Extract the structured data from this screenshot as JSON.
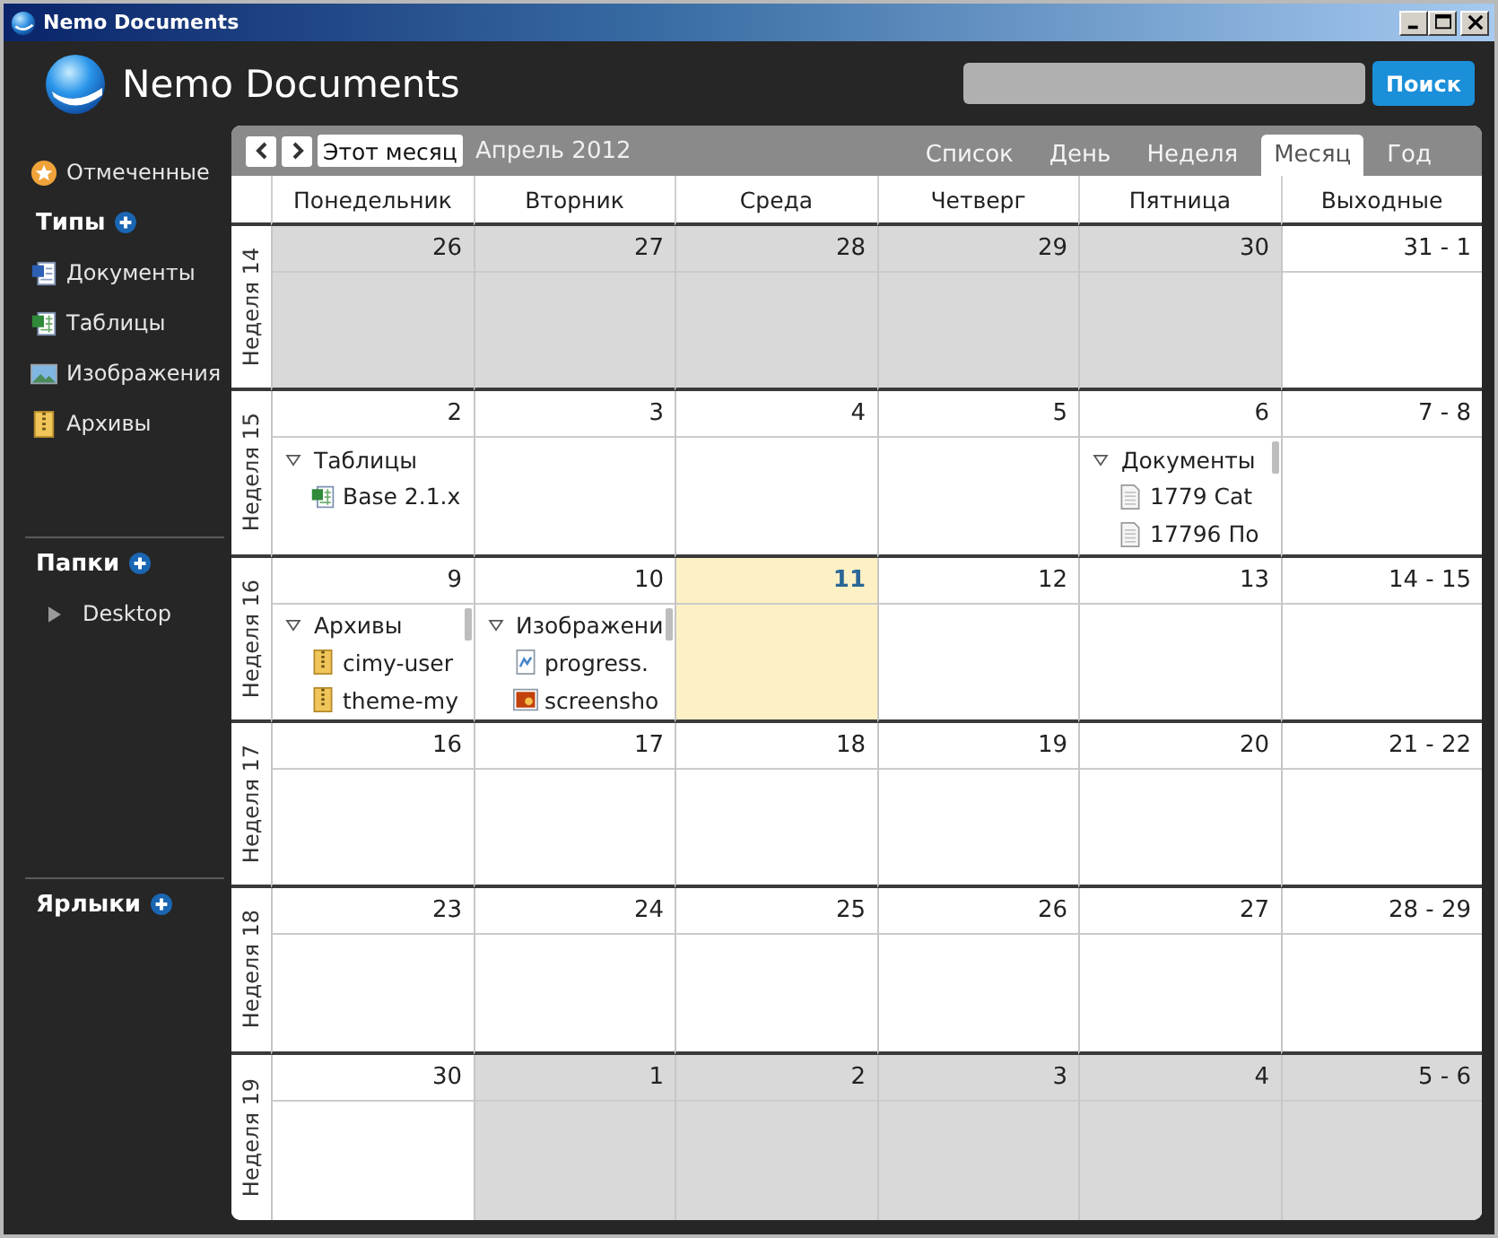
{
  "window": {
    "title": "Nemo Documents"
  },
  "header": {
    "app_name": "Nemo Documents",
    "search_button": "Поиск"
  },
  "sidebar": {
    "starred": "Отмеченные",
    "sections": [
      {
        "title": "Типы",
        "items": [
          {
            "label": "Документы",
            "kind": "document"
          },
          {
            "label": "Таблицы",
            "kind": "spreadsheet"
          },
          {
            "label": "Изображения",
            "kind": "image"
          },
          {
            "label": "Архивы",
            "kind": "archive"
          }
        ]
      },
      {
        "title": "Папки",
        "items": [
          {
            "label": "Desktop",
            "kind": "folder",
            "expanded": false
          }
        ]
      },
      {
        "title": "Ярлыки"
      }
    ]
  },
  "calendar": {
    "today_button": "Этот месяц",
    "period": "Апрель 2012",
    "views": [
      {
        "label": "Список",
        "selected": false
      },
      {
        "label": "День",
        "selected": false
      },
      {
        "label": "Неделя",
        "selected": false
      },
      {
        "label": "Месяц",
        "selected": true
      },
      {
        "label": "Год",
        "selected": false
      }
    ],
    "columns": [
      "Понедельник",
      "Вторник",
      "Среда",
      "Четверг",
      "Пятница",
      "Выходные"
    ],
    "weeks": [
      {
        "label": "Неделя 14",
        "days": [
          {
            "date": "26",
            "outside_month": true,
            "today": false
          },
          {
            "date": "27",
            "outside_month": true,
            "today": false
          },
          {
            "date": "28",
            "outside_month": true,
            "today": false
          },
          {
            "date": "29",
            "outside_month": true,
            "today": false
          },
          {
            "date": "30",
            "outside_month": true,
            "today": false
          },
          {
            "date": "31 - 1",
            "outside_month": false,
            "today": false
          }
        ]
      },
      {
        "label": "Неделя 15",
        "days": [
          {
            "date": "2",
            "outside_month": false,
            "today": false,
            "groups": [
              {
                "title": "Таблицы",
                "expanded": true,
                "scrollbar": false,
                "files": [
                  {
                    "name": "Base 2.1.x",
                    "kind": "spreadsheet"
                  }
                ]
              }
            ]
          },
          {
            "date": "3",
            "outside_month": false,
            "today": false
          },
          {
            "date": "4",
            "outside_month": false,
            "today": false
          },
          {
            "date": "5",
            "outside_month": false,
            "today": false
          },
          {
            "date": "6",
            "outside_month": false,
            "today": false,
            "groups": [
              {
                "title": "Документы",
                "expanded": true,
                "scrollbar": true,
                "files": [
                  {
                    "name": "1779 Cat",
                    "kind": "text"
                  },
                  {
                    "name": "17796 По",
                    "kind": "text"
                  }
                ]
              }
            ]
          },
          {
            "date": "7 - 8",
            "outside_month": false,
            "today": false
          }
        ]
      },
      {
        "label": "Неделя 16",
        "days": [
          {
            "date": "9",
            "outside_month": false,
            "today": false,
            "groups": [
              {
                "title": "Архивы",
                "expanded": true,
                "scrollbar": true,
                "files": [
                  {
                    "name": "cimy-user",
                    "kind": "archive"
                  },
                  {
                    "name": "theme-my",
                    "kind": "archive"
                  }
                ]
              }
            ]
          },
          {
            "date": "10",
            "outside_month": false,
            "today": false,
            "groups": [
              {
                "title": "Изображени",
                "expanded": true,
                "scrollbar": true,
                "files": [
                  {
                    "name": "progress.",
                    "kind": "image"
                  },
                  {
                    "name": "screensho",
                    "kind": "picture"
                  }
                ]
              }
            ]
          },
          {
            "date": "11",
            "outside_month": false,
            "today": true
          },
          {
            "date": "12",
            "outside_month": false,
            "today": false
          },
          {
            "date": "13",
            "outside_month": false,
            "today": false
          },
          {
            "date": "14 - 15",
            "outside_month": false,
            "today": false
          }
        ]
      },
      {
        "label": "Неделя 17",
        "days": [
          {
            "date": "16",
            "outside_month": false,
            "today": false
          },
          {
            "date": "17",
            "outside_month": false,
            "today": false
          },
          {
            "date": "18",
            "outside_month": false,
            "today": false
          },
          {
            "date": "19",
            "outside_month": false,
            "today": false
          },
          {
            "date": "20",
            "outside_month": false,
            "today": false
          },
          {
            "date": "21 - 22",
            "outside_month": false,
            "today": false
          }
        ]
      },
      {
        "label": "Неделя 18",
        "days": [
          {
            "date": "23",
            "outside_month": false,
            "today": false
          },
          {
            "date": "24",
            "outside_month": false,
            "today": false
          },
          {
            "date": "25",
            "outside_month": false,
            "today": false
          },
          {
            "date": "26",
            "outside_month": false,
            "today": false
          },
          {
            "date": "27",
            "outside_month": false,
            "today": false
          },
          {
            "date": "28 - 29",
            "outside_month": false,
            "today": false
          }
        ]
      },
      {
        "label": "Неделя 19",
        "days": [
          {
            "date": "30",
            "outside_month": false,
            "today": false
          },
          {
            "date": "1",
            "outside_month": true,
            "today": false
          },
          {
            "date": "2",
            "outside_month": true,
            "today": false
          },
          {
            "date": "3",
            "outside_month": true,
            "today": false
          },
          {
            "date": "4",
            "outside_month": true,
            "today": false
          },
          {
            "date": "5 - 6",
            "outside_month": true,
            "today": false
          }
        ]
      }
    ]
  }
}
